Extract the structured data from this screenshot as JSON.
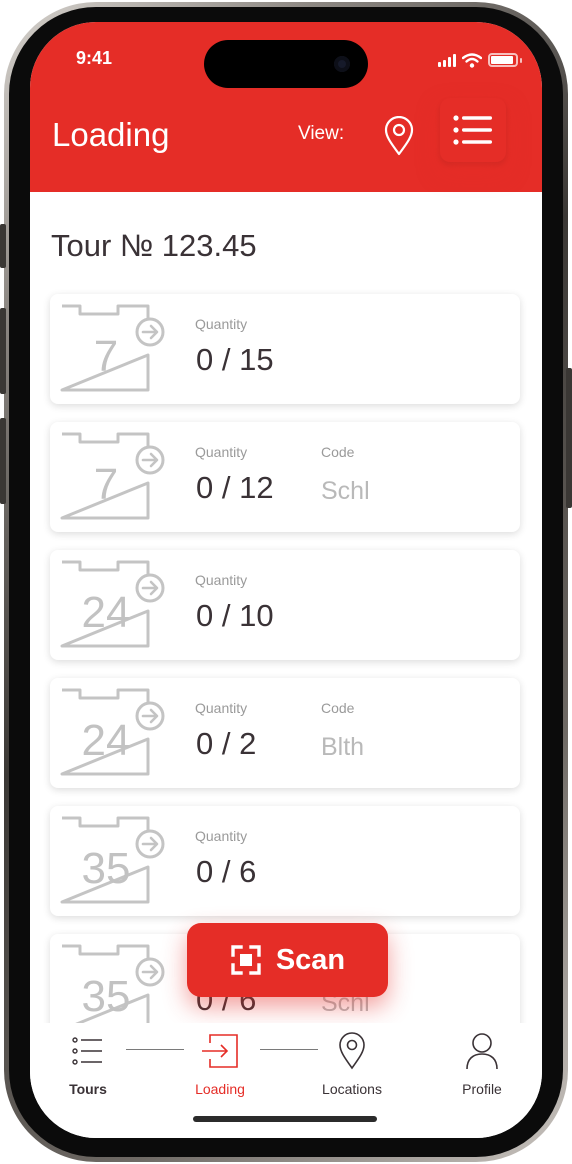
{
  "status": {
    "time": "9:41"
  },
  "header": {
    "title": "Loading",
    "view_label": "View:"
  },
  "tour": {
    "title": "Tour № 123.45"
  },
  "cards": [
    {
      "number": "7",
      "qty_label": "Quantity",
      "qty": "0 / 15",
      "code_label": "",
      "code": ""
    },
    {
      "number": "7",
      "qty_label": "Quantity",
      "qty": "0 / 12",
      "code_label": "Code",
      "code": "Schl"
    },
    {
      "number": "24",
      "qty_label": "Quantity",
      "qty": "0 / 10",
      "code_label": "",
      "code": ""
    },
    {
      "number": "24",
      "qty_label": "Quantity",
      "qty": "0 / 2",
      "code_label": "Code",
      "code": "Blth"
    },
    {
      "number": "35",
      "qty_label": "Quantity",
      "qty": "0 / 6",
      "code_label": "",
      "code": ""
    },
    {
      "number": "35",
      "qty_label": "Quantity",
      "qty": "0 / 6",
      "code_label": "Code",
      "code": "Schl"
    }
  ],
  "scan": {
    "label": "Scan"
  },
  "tabs": [
    {
      "label": "Tours",
      "active": false
    },
    {
      "label": "Loading",
      "active": true
    },
    {
      "label": "Locations",
      "active": false
    },
    {
      "label": "Profile",
      "active": false
    }
  ],
  "colors": {
    "accent": "#e52d27",
    "text": "#3a3236",
    "muted": "#c2c2c2"
  }
}
